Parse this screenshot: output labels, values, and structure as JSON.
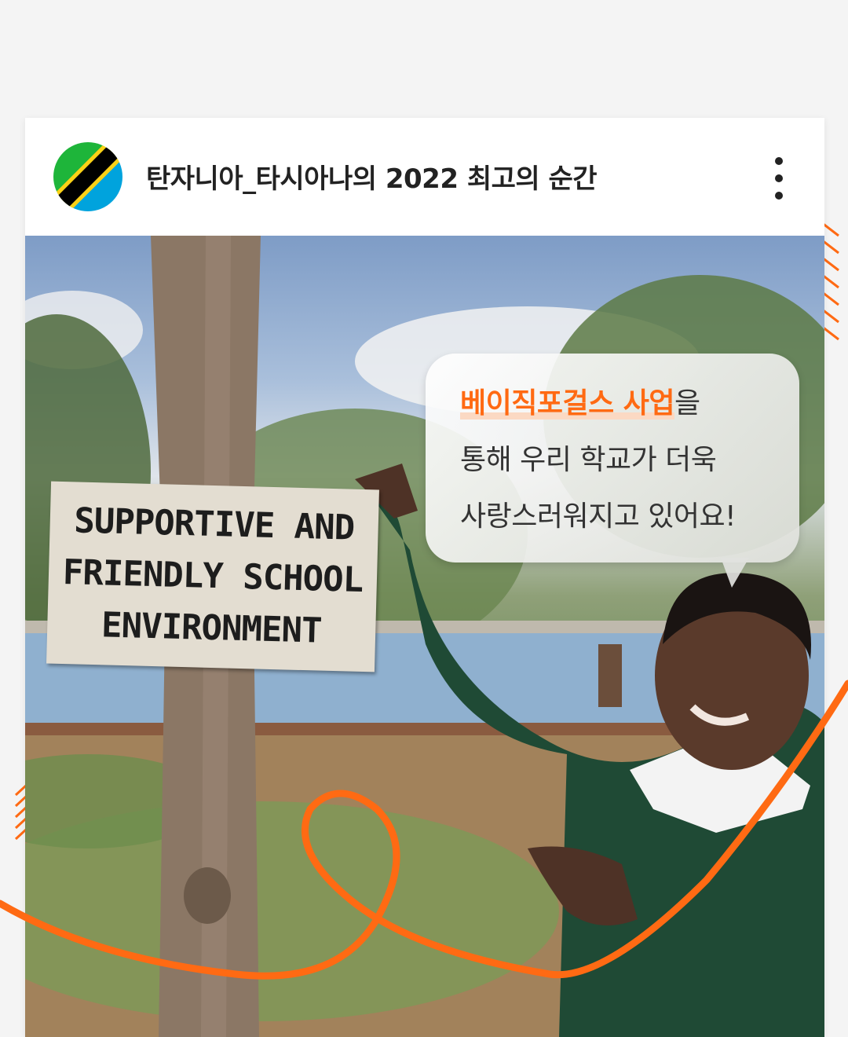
{
  "card": {
    "title": "탄자니아_타시아나의 2022 최고의 순간"
  },
  "sign": {
    "lines": [
      "SUPPORTIVE AND",
      "FRIENDLY SCHOOL",
      "ENVIRONMENT"
    ]
  },
  "bubble": {
    "highlight": "베이직포걸스 사업",
    "line1_rest": "을",
    "line2": "통해 우리 학교가 더욱",
    "line3": "사랑스러워지고 있어요!"
  },
  "colors": {
    "accent": "#ff6a13",
    "flag_green": "#1eb53a",
    "flag_blue": "#00a3dd",
    "flag_yellow": "#fcd116",
    "flag_black": "#000000"
  }
}
